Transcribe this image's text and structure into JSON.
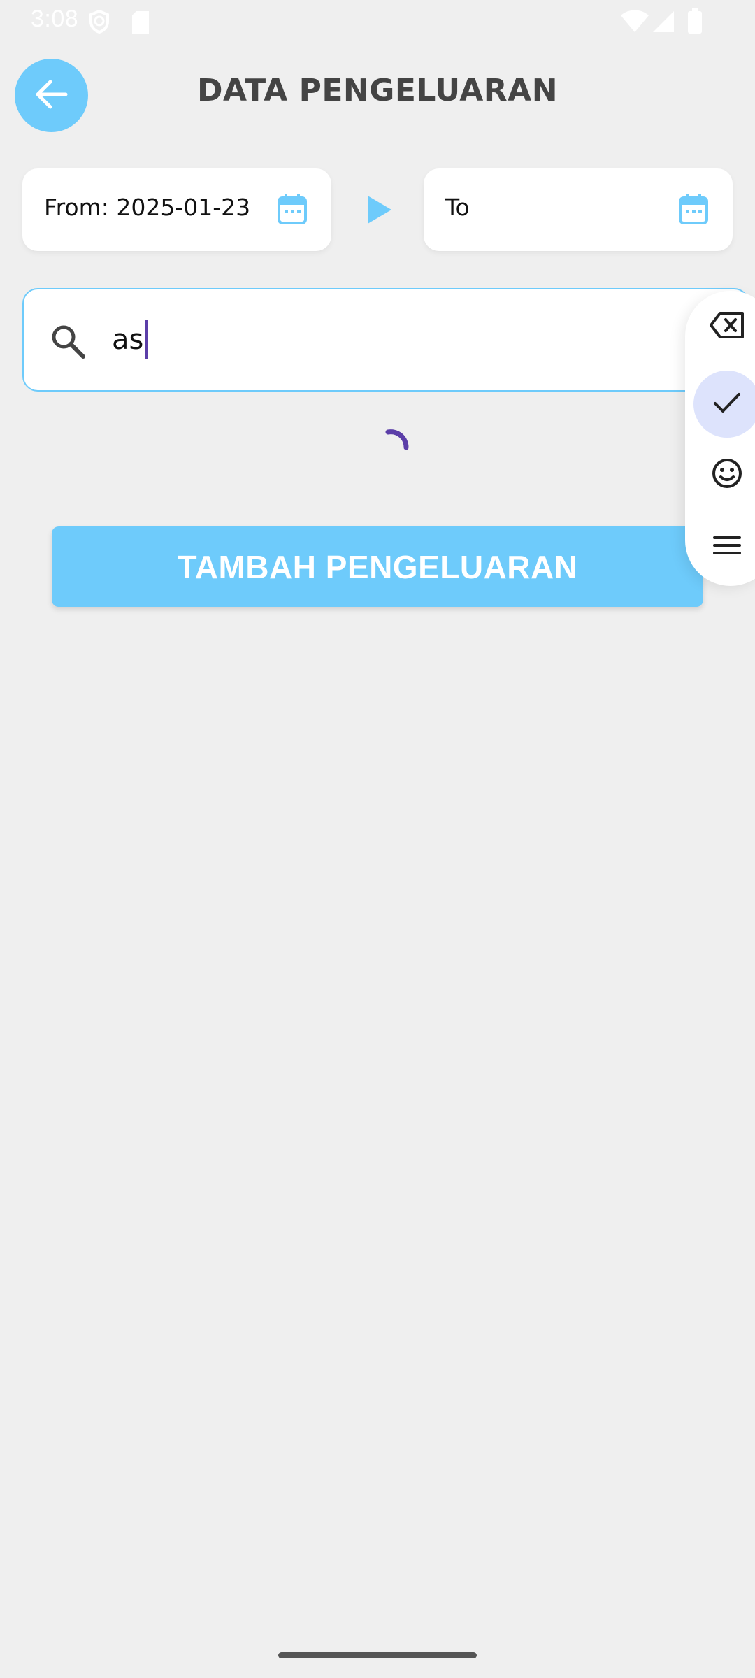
{
  "status_bar": {
    "time": "3:08",
    "icons": [
      "shield-icon",
      "sd-card-icon",
      "wifi-icon",
      "signal-icon",
      "battery-icon"
    ]
  },
  "header": {
    "title": "DATA PENGELUARAN",
    "back_icon": "arrow-left-icon"
  },
  "date_range": {
    "from_label": "From: 2025-01-23",
    "to_label": "To",
    "separator_icon": "play-arrow-icon"
  },
  "search": {
    "value": "as",
    "icon": "search-icon"
  },
  "loading": {
    "indicator": "spinner"
  },
  "actions": {
    "add_label": "TAMBAH PENGELUARAN"
  },
  "keyboard_toolbar": {
    "items": [
      "backspace-icon",
      "check-icon",
      "emoji-icon",
      "menu-icon"
    ],
    "active_item": "check-icon"
  },
  "colors": {
    "accent": "#6ecbfb",
    "background": "#efefef",
    "title": "#444444",
    "cursor": "#5b3ea8",
    "toolbar_active": "#dde3fc"
  }
}
